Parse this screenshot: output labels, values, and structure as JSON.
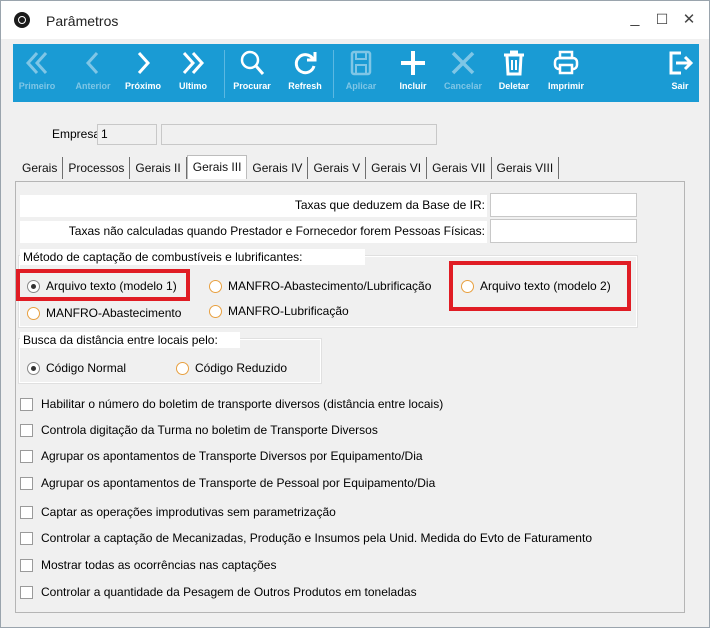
{
  "window": {
    "title": "Parâmetros",
    "minimize": "_",
    "maximize": "☐",
    "close": "✕"
  },
  "toolbar": {
    "buttons": [
      {
        "label": "Primeiro",
        "icon": "double-chevron-left-icon",
        "enabled": false
      },
      {
        "label": "Anterior",
        "icon": "chevron-left-icon",
        "enabled": false
      },
      {
        "label": "Próximo",
        "icon": "chevron-right-icon",
        "enabled": true
      },
      {
        "label": "Ultimo",
        "icon": "double-chevron-right-icon",
        "enabled": true
      },
      {
        "label": "Procurar",
        "icon": "search-icon",
        "enabled": true
      },
      {
        "label": "Refresh",
        "icon": "refresh-icon",
        "enabled": true
      },
      {
        "label": "Aplicar",
        "icon": "save-icon",
        "enabled": false
      },
      {
        "label": "Incluir",
        "icon": "plus-icon",
        "enabled": true
      },
      {
        "label": "Cancelar",
        "icon": "x-icon",
        "enabled": false
      },
      {
        "label": "Deletar",
        "icon": "trash-icon",
        "enabled": true
      },
      {
        "label": "Imprimir",
        "icon": "printer-icon",
        "enabled": true
      },
      {
        "label": "Sair",
        "icon": "exit-icon",
        "enabled": true
      }
    ],
    "color": "#1a9bd4"
  },
  "empresa": {
    "label": "Empresa:",
    "value": "1",
    "name": ""
  },
  "tabs": [
    "Gerais",
    "Processos",
    "Gerais II",
    "Gerais III",
    "Gerais IV",
    "Gerais V",
    "Gerais VI",
    "Gerais VII",
    "Gerais VIII"
  ],
  "active_tab": "Gerais III",
  "taxes": {
    "deduzem_label": "Taxas que deduzem da Base de IR:",
    "nao_calculadas_label": "Taxas não calculadas quando Prestador e Fornecedor forem Pessoas Físicas:"
  },
  "metodo": {
    "title": "Método de captação de combustíveis e lubrificantes:",
    "options": [
      "Arquivo texto (modelo 1)",
      "MANFRO-Abastecimento/Lubrificação",
      "Arquivo texto (modelo 2)",
      "MANFRO-Abastecimento",
      "MANFRO-Lubrificação"
    ],
    "selected": "Arquivo texto (modelo 1)"
  },
  "busca": {
    "title": "Busca da distância entre locais pelo:",
    "options": [
      "Código Normal",
      "Código Reduzido"
    ],
    "selected": "Código Normal"
  },
  "checkboxes": [
    "Habilitar o número do boletim de transporte diversos (distância entre locais)",
    "Controla digitação da Turma no boletim de Transporte Diversos",
    "Agrupar os apontamentos de Transporte Diversos por Equipamento/Dia",
    "Agrupar os apontamentos de Transporte de Pessoal por Equipamento/Dia",
    "Captar as operações improdutivas sem parametrização",
    "Controlar a captação de Mecanizadas, Produção e Insumos pela Unid. Medida do Evto de Faturamento",
    "Mostrar todas as ocorrências nas captações",
    "Controlar a quantidade da Pesagem de Outros Produtos em toneladas"
  ],
  "highlight_color": "#e01c24"
}
